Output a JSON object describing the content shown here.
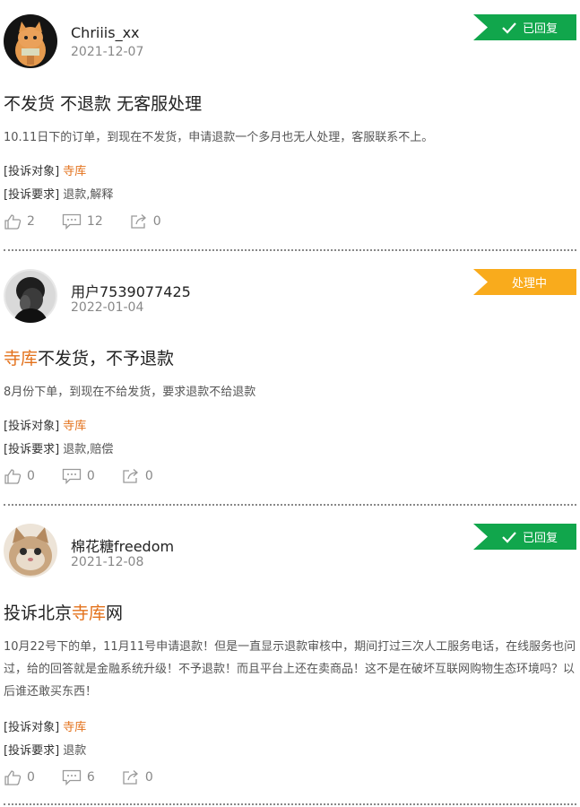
{
  "colors": {
    "replied": "#11a64c",
    "processing": "#f9ab1c",
    "highlight": "#e3711b"
  },
  "labels": {
    "object": "[投诉对象]",
    "request": "[投诉要求]"
  },
  "complaints": [
    {
      "user": "Chriiis_xx",
      "date": "2021-12-07",
      "status": "已回复",
      "title_pre": "不发货 不退款 无客服处理",
      "title_hl": "",
      "title_post": "",
      "desc": "10.11日下的订单，到现在不发货，申请退款一个多月也无人处理，客服联系不上。",
      "object": "寺库",
      "request": "退款,解释",
      "likes": "2",
      "comments": "12",
      "shares": "0"
    },
    {
      "user": "用户7539077425",
      "date": "2022-01-04",
      "status": "处理中",
      "title_pre": "",
      "title_hl": "寺库",
      "title_post": "不发货，不予退款",
      "desc": "8月份下单，到现在不给发货，要求退款不给退款",
      "object": "寺库",
      "request": "退款,赔偿",
      "likes": "0",
      "comments": "0",
      "shares": "0"
    },
    {
      "user": "棉花糖freedom",
      "date": "2021-12-08",
      "status": "已回复",
      "title_pre": "投诉北京",
      "title_hl": "寺库",
      "title_post": "网",
      "desc": "10月22号下的单，11月11号申请退款！但是一直显示退款审核中，期间打过三次人工服务电话，在线服务也问过，给的回答就是金融系统升级！不予退款！而且平台上还在卖商品！这不是在破坏互联网购物生态环境吗？以后谁还敢买东西！",
      "object": "寺库",
      "request": "退款",
      "likes": "0",
      "comments": "6",
      "shares": "0"
    }
  ]
}
